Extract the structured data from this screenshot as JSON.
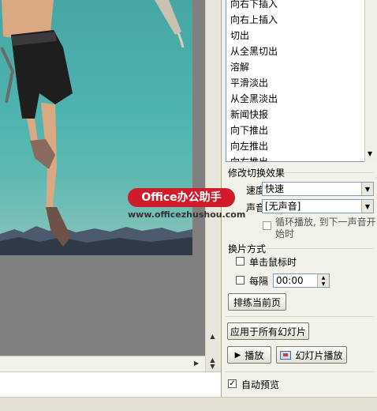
{
  "transition_list": {
    "items": [
      "向右下插入",
      "向右上插入",
      "切出",
      "从全黑切出",
      "溶解",
      "平滑淡出",
      "从全黑淡出",
      "新闻快报",
      "向下推出",
      "向左推出",
      "向右推出"
    ]
  },
  "modify_transition": {
    "title": "修改切换效果",
    "speed_label": "速度:",
    "speed_value": "快速",
    "sound_label": "声音:",
    "sound_value": "[无声音]",
    "loop_label_line1": "循环播放, 到下一声音开",
    "loop_label_line2": "始时",
    "loop_checked": false
  },
  "advance_slide": {
    "title": "换片方式",
    "on_click_label": "单击鼠标时",
    "on_click_checked": false,
    "every_label": "每隔",
    "every_checked": false,
    "every_value": "00:00",
    "rehearse_button": "排练当前页"
  },
  "actions": {
    "apply_all_button": "应用于所有幻灯片",
    "play_button": "播放",
    "slideshow_button": "幻灯片播放",
    "autopreview_label": "自动预览",
    "autopreview_checked": true
  },
  "icons": {
    "play": "play-icon",
    "slideshow": "slideshow-icon",
    "dropdown": "chevron-down-icon"
  },
  "watermark": {
    "brand": "Office办公助手",
    "url": "www.officezhushou.com"
  },
  "colors": {
    "accent_red": "#cf1b2a",
    "field_border": "#7f9db9",
    "pane_bg": "#f2f1ea"
  }
}
